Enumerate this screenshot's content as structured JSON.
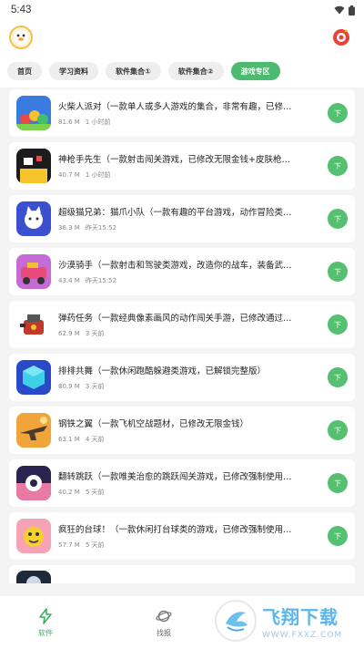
{
  "status": {
    "time": "5:43"
  },
  "colors": {
    "accent": "#4cba6f",
    "download": "#55c06f"
  },
  "tabs": [
    {
      "label": "首页",
      "active": false
    },
    {
      "label": "学习资料",
      "active": false
    },
    {
      "label": "软件集合①",
      "active": false
    },
    {
      "label": "软件集合②",
      "active": false
    },
    {
      "label": "游戏专区",
      "active": true
    }
  ],
  "items": [
    {
      "title": "火柴人派对（一款单人或多人游戏的集合，非常有趣，已修…",
      "size": "81.6 M",
      "time": "1 小时前",
      "icon": "stickman-party-icon"
    },
    {
      "title": "神枪手先生（一款射击闯关游戏，已修改无限金钱+皮肤枪…",
      "size": "40.7 M",
      "time": "1 小时前",
      "icon": "mr-gun-icon"
    },
    {
      "title": "超级猫兄弟：猫爪小队（一款有趣的平台游戏，动作冒险类…",
      "size": "36.3 M",
      "time": "昨天15:52",
      "icon": "cat-squad-icon"
    },
    {
      "title": "沙漠骑手（一款射击和驾驶类游戏，改造你的战车，装备武…",
      "size": "43.4 M",
      "time": "昨天15:52",
      "icon": "desert-rider-icon"
    },
    {
      "title": "弹药任务（一款经典像素画风的动作闯关手游，已修改通过…",
      "size": "62.9 M",
      "time": "3 天前",
      "icon": "ammo-mission-icon"
    },
    {
      "title": "排排共舞（一款休闲跑酷躲避类游戏，已解锁完整版）",
      "size": "80.9 M",
      "time": "3 天前",
      "icon": "cube-dance-icon"
    },
    {
      "title": "钢铁之翼（一款飞机空战题材，已修改无限金钱）",
      "size": "63.1 M",
      "time": "4 天前",
      "icon": "steel-wings-icon"
    },
    {
      "title": "翻转跳跃（一款唯美治愈的跳跃闯关游戏，已修改强制使用…",
      "size": "40.2 M",
      "time": "5 天前",
      "icon": "flip-jump-icon"
    },
    {
      "title": "疯狂的台球！（一款休闲打台球类的游戏，已修改强制使用…",
      "size": "57.7 M",
      "time": "5 天前",
      "icon": "crazy-billiards-icon"
    }
  ],
  "download_label": "下",
  "nav": [
    {
      "label": "软件",
      "active": true,
      "icon": "lightning-icon"
    },
    {
      "label": "找报",
      "active": false,
      "icon": "planet-icon"
    }
  ],
  "watermark": {
    "text": "飞翔下载",
    "url": "WWW.FXXZ.COM"
  }
}
